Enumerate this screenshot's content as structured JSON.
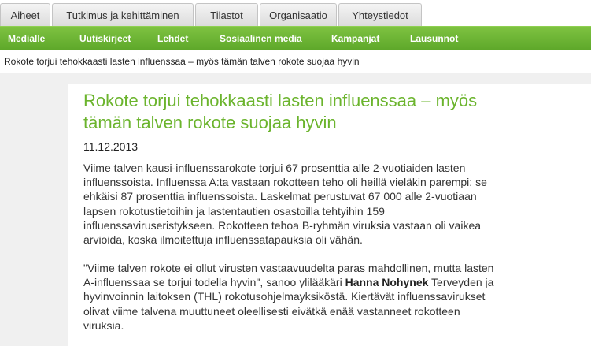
{
  "tabs": [
    "Aiheet",
    "Tutkimus ja kehittäminen",
    "Tilastot",
    "Organisaatio",
    "Yhteystiedot"
  ],
  "green_nav": [
    "Medialle",
    "Uutiskirjeet",
    "Lehdet",
    "Sosiaalinen media",
    "Kampanjat",
    "Lausunnot"
  ],
  "breadcrumb": "Rokote torjui tehokkaasti lasten influenssaa – myös tämän talven rokote suojaa hyvin",
  "article": {
    "title_line1": "Rokote torjui tehokkaasti lasten influenssaa – myös",
    "title_line2": "tämän talven rokote suojaa hyvin",
    "date": "11.12.2013",
    "p1_lines": [
      "Viime talven kausi-influenssarokote torjui 67 prosenttia alle 2-vuotiaiden lasten",
      "influenssoista. Influenssa A:ta vastaan rokotteen teho oli heillä vieläkin parempi: se",
      "ehkäisi 87 prosenttia influenssoista. Laskelmat perustuvat 67 000 alle 2-vuotiaan",
      "lapsen rokotustietoihin ja lastentautien osastoilla tehtyihin 159",
      "influenssaviruseristykseen. Rokotteen tehoa B-ryhmän viruksia vastaan oli vaikea",
      "arvioida, koska ilmoitettuja influenssatapauksia oli vähän."
    ],
    "p2_line1": "\"Viime talven rokote ei ollut virusten vastaavuudelta paras mahdollinen, mutta lasten",
    "p2_line2_before": "A-influenssaa se torjui todella hyvin\", sanoo ylilääkäri ",
    "p2_line2_bold": "Hanna Nohynek",
    "p2_line2_after": " Terveyden ja",
    "p2_rest": [
      "hyvinvoinnin laitoksen (THL) rokotusohjelmayksiköstä. Kiertävät influenssavirukset",
      "olivat viime talvena muuttuneet oleellisesti eivätkä enää vastanneet rokotteen",
      "viruksia."
    ]
  },
  "colors": {
    "green": "#6bb42d",
    "nav_green": "#5ea82a"
  }
}
